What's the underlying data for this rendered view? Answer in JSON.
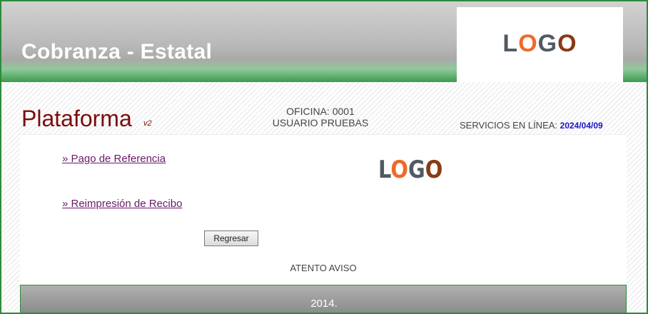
{
  "header": {
    "title": "Cobranza - Estatal",
    "logo": [
      "L",
      "O",
      "G",
      "O"
    ]
  },
  "platform": {
    "name": "Plataforma",
    "version": "v2"
  },
  "office": {
    "line1": "OFICINA: 0001",
    "line2": "USUARIO PRUEBAS"
  },
  "services": {
    "label": "SERVICIOS EN LÍNEA:",
    "date": "2024/04/09"
  },
  "menu": {
    "items": [
      {
        "label": "» Pago de Referencia"
      },
      {
        "label": "» Reimpresión de Recibo"
      }
    ]
  },
  "content_logo": [
    "L",
    "O",
    "G",
    "O"
  ],
  "buttons": {
    "back_label": "Regresar"
  },
  "notice": "ATENTO AVISO",
  "footer": {
    "text": "2014."
  },
  "colors": {
    "brand_green": "#2e8b3a",
    "title_red": "#7a0c0c",
    "date_blue": "#1a14c8",
    "link_purple": "#6a1a6a"
  }
}
